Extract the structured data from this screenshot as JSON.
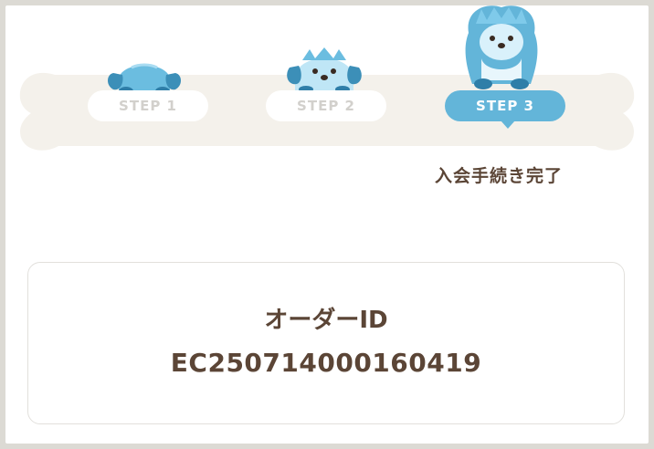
{
  "steps": [
    {
      "label": "STEP 1",
      "state": "done"
    },
    {
      "label": "STEP 2",
      "state": "done"
    },
    {
      "label": "STEP 3",
      "state": "active"
    }
  ],
  "current_step_caption": "入会手続き完了",
  "order": {
    "title": "オーダーID",
    "id": "EC250714000160419"
  },
  "colors": {
    "accent": "#63b5d9",
    "text": "#5b4536",
    "bone": "#f4f1eb"
  },
  "icons": [
    "dog-peek-icon",
    "dog-peek-icon",
    "dog-sitting-icon"
  ]
}
